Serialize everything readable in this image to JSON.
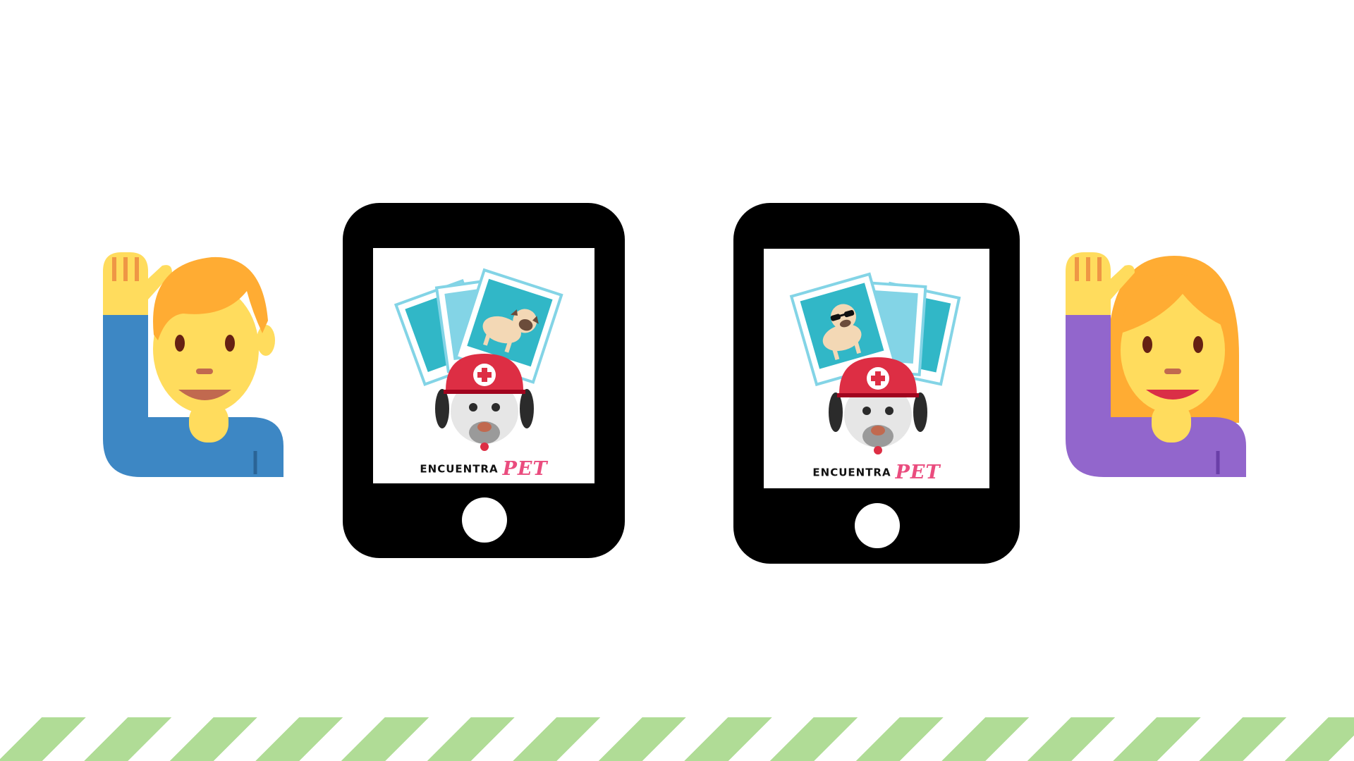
{
  "scene": {
    "background_color": "#ffffff"
  },
  "people": {
    "left": {
      "icon": "man-raising-hand-icon",
      "shirt_color": "#3d87c4",
      "hair_color": "#ffac33"
    },
    "right": {
      "icon": "woman-raising-hand-icon",
      "shirt_color": "#9266cc",
      "hair_color": "#ffac33"
    }
  },
  "tablets": {
    "left": {
      "icon": "tablet-icon",
      "app_logo": "photos-pug-rescue-dog-icon",
      "brand_word": "ENCUENTRA",
      "brand_accent": "PET"
    },
    "right": {
      "icon": "tablet-icon",
      "app_logo": "photos-sunglasses-pug-rescue-dog-icon",
      "brand_word": "ENCUENTRA",
      "brand_accent": "PET"
    }
  },
  "colors": {
    "skin": "#ffdc5d",
    "photo_frame": "#83d4e6",
    "photo_fill": "#31b7c7",
    "helmet": "#dd2e44",
    "brand_accent": "#ea4c7e",
    "stripe": "#b0dc96"
  },
  "footer": {
    "pattern": "diagonal-stripes",
    "stripe_color": "#b0dc96"
  }
}
